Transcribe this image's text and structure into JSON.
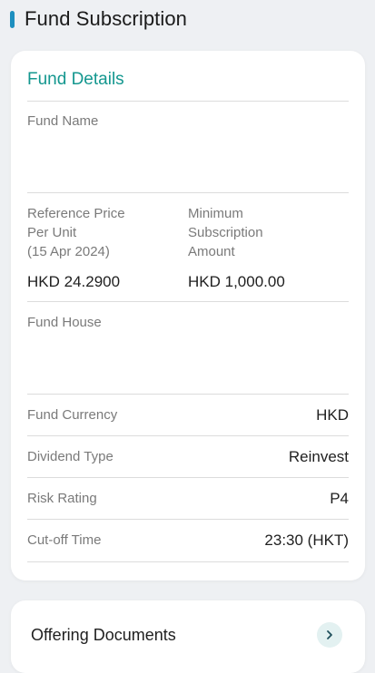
{
  "header": {
    "title": "Fund Subscription"
  },
  "fund_details": {
    "title": "Fund Details",
    "fund_name_label": "Fund Name",
    "fund_name_value": "",
    "reference_price_label_line1": "Reference Price",
    "reference_price_label_line2": "Per Unit",
    "reference_price_label_line3": "(15 Apr 2024)",
    "reference_price_value": "HKD 24.2900",
    "min_subscription_label_line1": "Minimum",
    "min_subscription_label_line2": "Subscription",
    "min_subscription_label_line3": "Amount",
    "min_subscription_value": "HKD 1,000.00",
    "fund_house_label": "Fund House",
    "fund_house_value": "",
    "rows": [
      {
        "label": "Fund Currency",
        "value": "HKD"
      },
      {
        "label": "Dividend Type",
        "value": "Reinvest"
      },
      {
        "label": "Risk Rating",
        "value": "P4"
      },
      {
        "label": "Cut-off Time",
        "value": "23:30 (HKT)"
      }
    ]
  },
  "documents": {
    "label": "Offering Documents",
    "icon": "chevron-right-icon"
  },
  "colors": {
    "accent": "#14978f",
    "header_bar": "#1d8fbf",
    "background": "#eef0f3"
  }
}
